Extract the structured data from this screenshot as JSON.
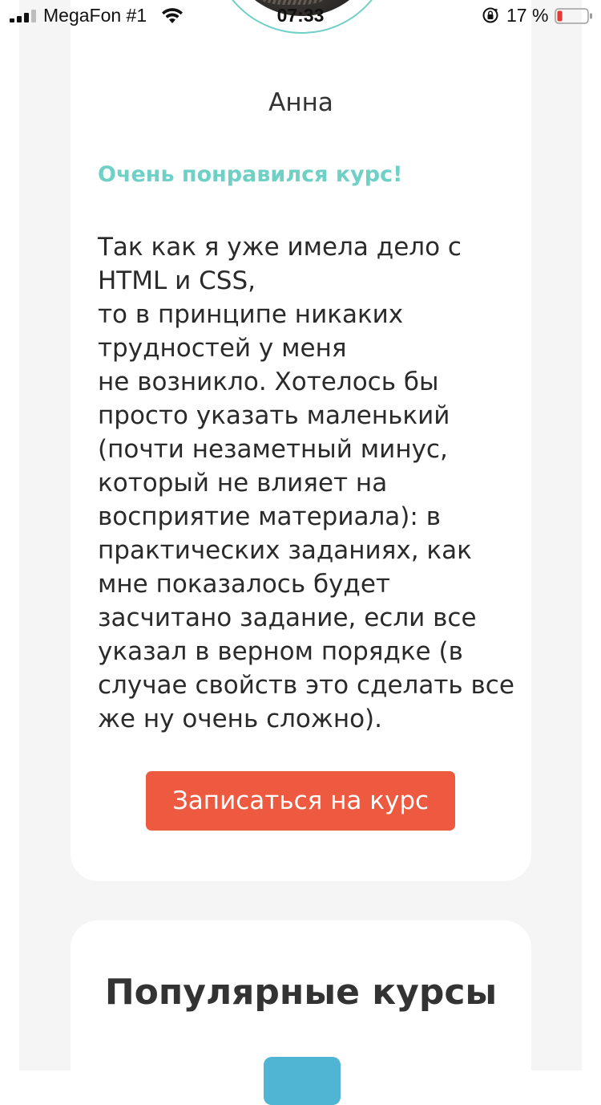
{
  "status_bar": {
    "carrier": "MegaFon #1",
    "time": "07:33",
    "battery": "17 %",
    "battery_level": 0.17,
    "signal_bars": 3,
    "icons": [
      "signal-icon",
      "wifi-icon",
      "rotation-lock-icon",
      "battery-icon"
    ]
  },
  "review": {
    "name": "Анна",
    "title": "Очень понравился курс!",
    "lines": [
      "Так как я уже имела дело с",
      "HTML и CSS,",
      "то в принципе никаких",
      "трудностей у меня",
      "не возникло. Хотелось бы",
      "просто указать маленький",
      "(почти незаметный минус,",
      "который не влияет на",
      "восприятие материала): в",
      "практических заданиях, как",
      "мне показалось будет",
      "засчитано задание, если все",
      "указал в верном порядке (в",
      "случае свойств это сделать все",
      "же ну очень сложно)."
    ],
    "button_label": "Записаться на курс"
  },
  "popular": {
    "title": "Популярные курсы"
  },
  "colors": {
    "accent": "#6fd0c6",
    "button": "#ee5a3f",
    "page_bg": "#f5f5f5",
    "tile": "#4fb5d2",
    "battery_low": "#e53935"
  }
}
